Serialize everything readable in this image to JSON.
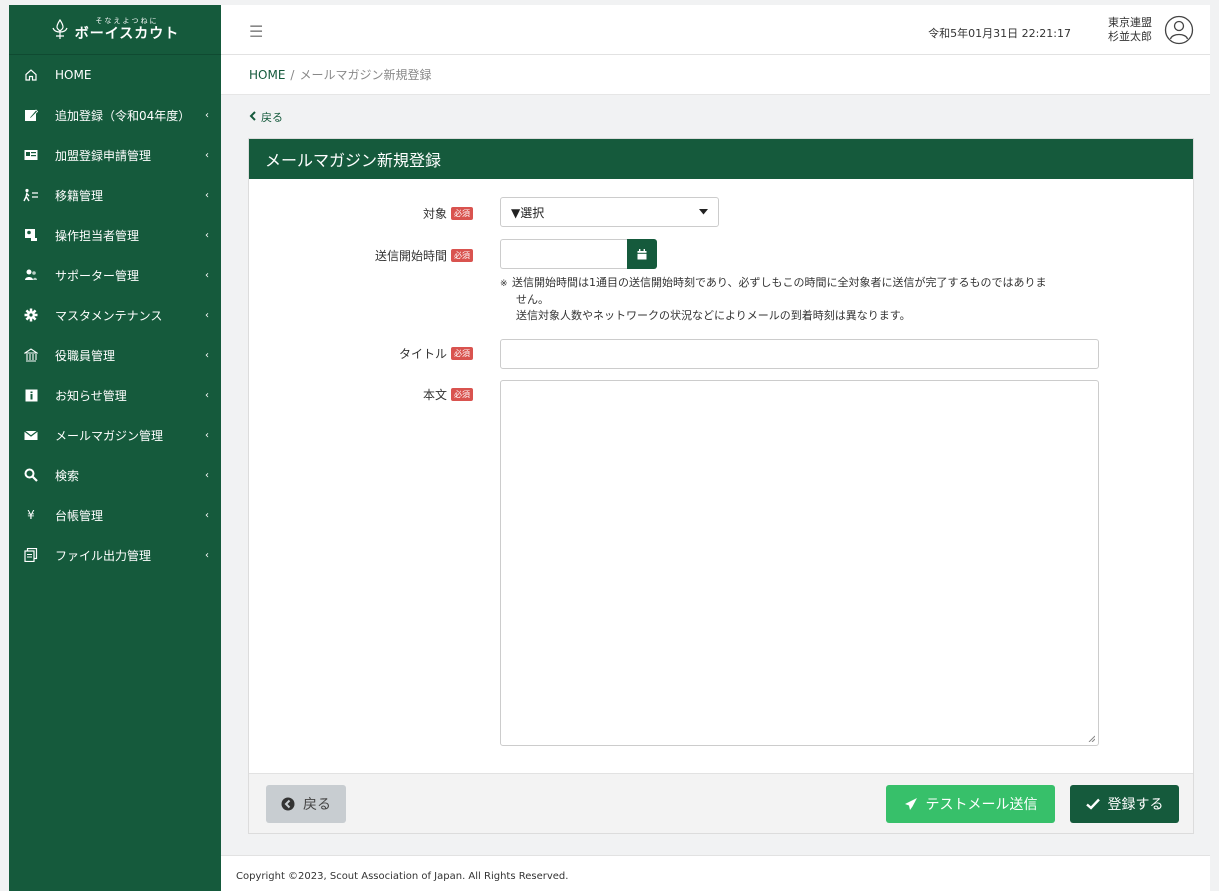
{
  "brand": {
    "tagline": "そなえよつねに",
    "name": "ボーイスカウト"
  },
  "sidebar": {
    "items": [
      {
        "label": "HOME",
        "icon": "home-icon",
        "has_children": false
      },
      {
        "label": "追加登録（令和04年度）",
        "icon": "edit-icon",
        "has_children": true
      },
      {
        "label": "加盟登録申請管理",
        "icon": "id-card-icon",
        "has_children": true
      },
      {
        "label": "移籍管理",
        "icon": "transfer-icon",
        "has_children": true
      },
      {
        "label": "操作担当者管理",
        "icon": "operator-icon",
        "has_children": true
      },
      {
        "label": "サポーター管理",
        "icon": "users-icon",
        "has_children": true
      },
      {
        "label": "マスタメンテナンス",
        "icon": "gear-icon",
        "has_children": true
      },
      {
        "label": "役職員管理",
        "icon": "building-icon",
        "has_children": true
      },
      {
        "label": "お知らせ管理",
        "icon": "info-icon",
        "has_children": true
      },
      {
        "label": "メールマガジン管理",
        "icon": "envelope-icon",
        "has_children": true
      },
      {
        "label": "検索",
        "icon": "search-icon",
        "has_children": true
      },
      {
        "label": "台帳管理",
        "icon": "yen-icon",
        "has_children": true
      },
      {
        "label": "ファイル出力管理",
        "icon": "files-icon",
        "has_children": true
      }
    ]
  },
  "header": {
    "datetime": "令和5年01月31日 22:21:17",
    "org": "東京連盟",
    "user": "杉並太郎"
  },
  "breadcrumb": {
    "home": "HOME",
    "separator": "/",
    "current": "メールマガジン新規登録"
  },
  "back_link": "戻る",
  "form": {
    "title": "メールマガジン新規登録",
    "required_badge": "必須",
    "target": {
      "label": "対象",
      "value": "▼選択"
    },
    "send_start": {
      "label": "送信開始時間",
      "value": "",
      "note_mark": "※",
      "note_line1": "送信開始時間は1通目の送信開始時刻であり、必ずしもこの時間に全対象者に送信が完了するものではありま",
      "note_line2": "せん。",
      "note_line3": "送信対象人数やネットワークの状況などによりメールの到着時刻は異なります。"
    },
    "mail_title": {
      "label": "タイトル",
      "value": ""
    },
    "body": {
      "label": "本文",
      "value": ""
    }
  },
  "buttons": {
    "back": "戻る",
    "test_send": "テストメール送信",
    "register": "登録する"
  },
  "footer": {
    "copyright": "Copyright ©2023, Scout Association of Japan. All Rights Reserved."
  },
  "colors": {
    "primary": "#155a3c",
    "success": "#37c06a",
    "danger": "#d9534f"
  }
}
